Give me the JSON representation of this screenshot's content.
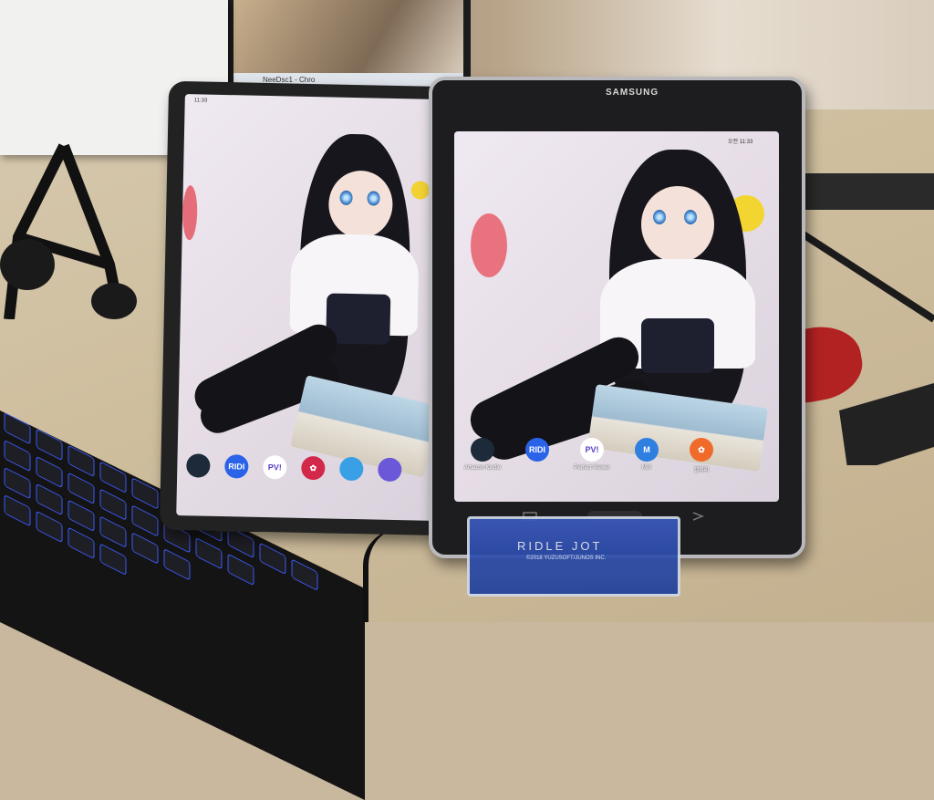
{
  "scene": "two-tablets-on-desk",
  "laptop": {
    "taskbar_text": "NeeDsc1 - Chro"
  },
  "left_tablet": {
    "status_time": "11:33",
    "dock_apps": [
      {
        "name": "kindle-icon",
        "label": "",
        "color": "#1d2a3a",
        "text": ""
      },
      {
        "name": "ridi-icon",
        "label": "",
        "color": "#2a63e8",
        "text": "RIDI"
      },
      {
        "name": "perfect-viewer-icon",
        "label": "",
        "color": "#ffffff",
        "text": "PV!"
      },
      {
        "name": "gallery-icon",
        "label": "",
        "color": "#d2284a",
        "text": "✿"
      },
      {
        "name": "weather-icon",
        "label": "",
        "color": "#3aa0e6",
        "text": ""
      },
      {
        "name": "samsung-internet-icon",
        "label": "",
        "color": "#6a58d8",
        "text": ""
      }
    ]
  },
  "right_tablet": {
    "brand": "SAMSUNG",
    "status_time": "오전 11:33",
    "dock_apps": [
      {
        "name": "kindle-icon",
        "label": "Amazon Kindle",
        "color": "#1d2a3a",
        "text": ""
      },
      {
        "name": "ridi-icon",
        "label": "",
        "color": "#2a63e8",
        "text": "RIDI"
      },
      {
        "name": "perfect-viewer-icon",
        "label": "Perfect Viewer",
        "color": "#ffffff",
        "text": "PV!"
      },
      {
        "name": "mix-icon",
        "label": "MiX",
        "color": "#2f7fe0",
        "text": "M"
      },
      {
        "name": "gallery-icon",
        "label": "갤러리",
        "color": "#f06a2a",
        "text": "✿"
      }
    ]
  },
  "stand_card": {
    "title": "RIDLE JOT",
    "subtitle": "©2018 YUZUSOFT/JUNOS INC."
  }
}
